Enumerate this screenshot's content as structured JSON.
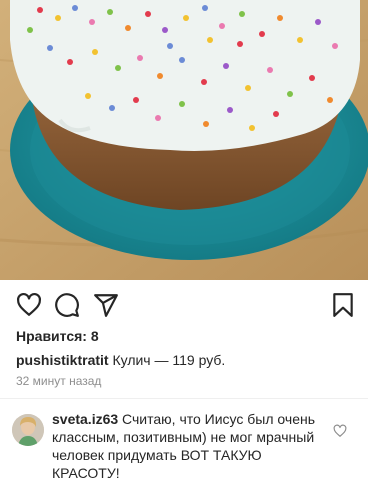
{
  "post": {
    "image_description_icon": "cake-photo",
    "likes_label": "Нравится: 8",
    "caption_user": "pushistiktratit",
    "caption_text": " Кулич — 119 руб.",
    "time_ago": "32 минут назад"
  },
  "actions": {
    "like_icon": "heart-icon",
    "comment_icon": "comment-icon",
    "share_icon": "share-icon",
    "save_icon": "bookmark-icon"
  },
  "comment": {
    "user": "sveta.iz63",
    "text": " Считаю, что Иисус был очень классным, позитивным) не мог мрачный человек придумать ВОТ ТАКУЮ КРАСОТУ!",
    "like_icon": "heart-icon"
  },
  "colors": {
    "plate": "#1f8f9b",
    "icing": "#eef3f1",
    "cake": "#8a5a34",
    "table": "#c9a56b"
  }
}
